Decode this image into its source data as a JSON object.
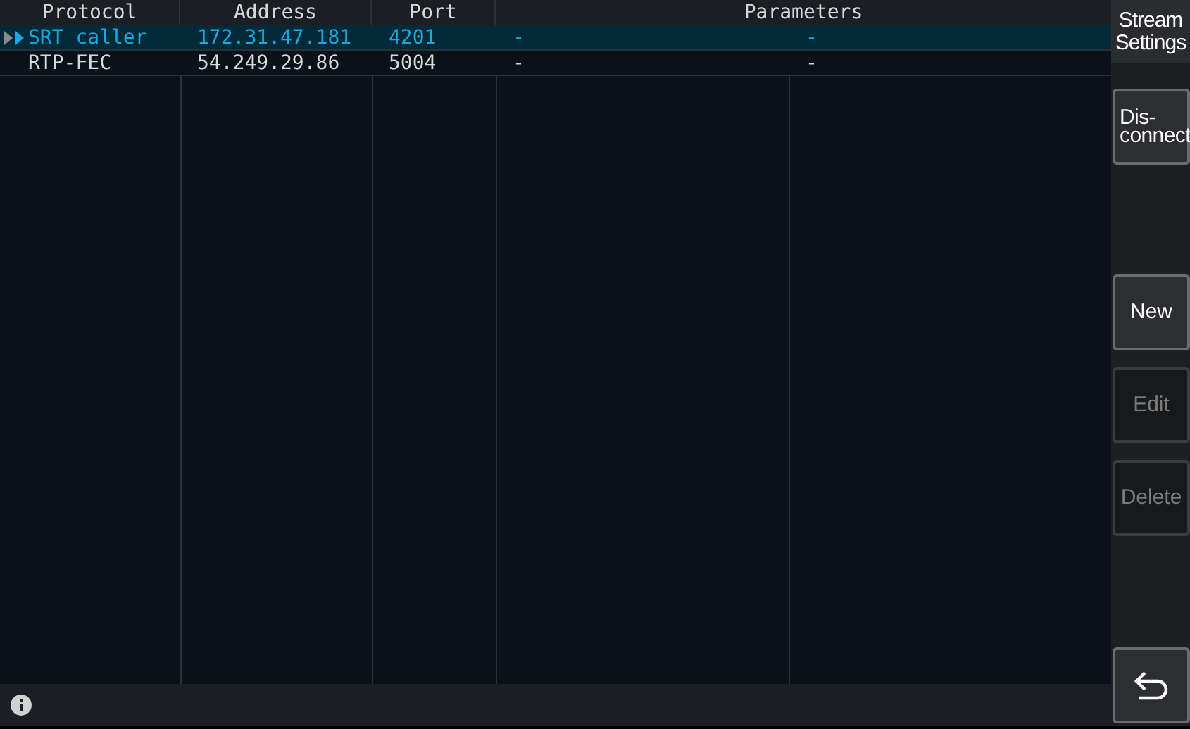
{
  "table": {
    "columns": [
      "Protocol",
      "Address",
      "Port",
      "Parameters"
    ],
    "rows": [
      {
        "selected": true,
        "cells": [
          "SRT caller",
          "172.31.47.181",
          "4201"
        ],
        "parameters": [
          "-",
          "-"
        ]
      },
      {
        "selected": false,
        "cells": [
          "RTP-FEC",
          "54.249.29.86",
          "5004"
        ],
        "parameters": [
          "-",
          "-"
        ]
      }
    ]
  },
  "side_panel": {
    "title": "Stream Settings",
    "buttons": [
      {
        "kind": "text",
        "label": "Dis-connect",
        "disabled": false
      },
      {
        "kind": "spacer"
      },
      {
        "kind": "text",
        "label": "New",
        "disabled": false
      },
      {
        "kind": "text",
        "label": "Edit",
        "disabled": true
      },
      {
        "kind": "text",
        "label": "Delete",
        "disabled": true
      },
      {
        "kind": "back",
        "disabled": false
      }
    ]
  }
}
